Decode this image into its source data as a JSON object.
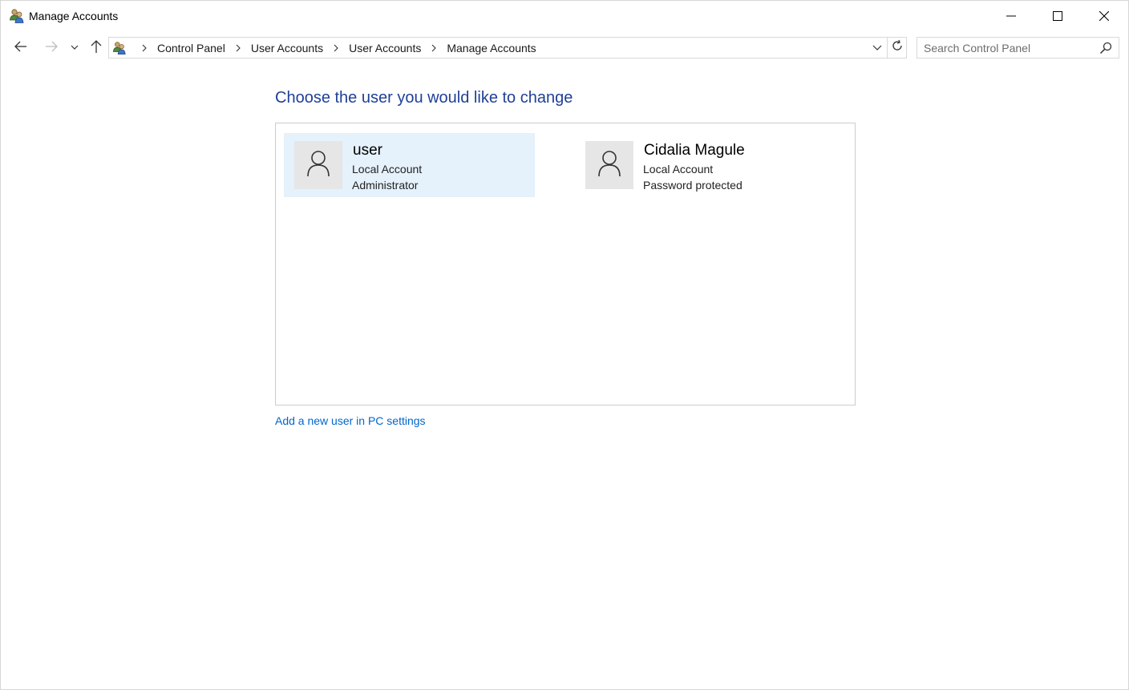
{
  "window": {
    "title": "Manage Accounts",
    "icon": "user-accounts-icon"
  },
  "controls": {
    "minimize_icon": "minimize-icon",
    "maximize_icon": "maximize-icon",
    "close_icon": "close-icon"
  },
  "nav": {
    "back_icon": "arrow-left-icon",
    "forward_icon": "arrow-right-icon",
    "recent_icon": "chevron-down-icon",
    "up_icon": "arrow-up-icon"
  },
  "address": {
    "icon": "user-accounts-icon",
    "breadcrumbs": [
      "Control Panel",
      "User Accounts",
      "User Accounts",
      "Manage Accounts"
    ],
    "dropdown_icon": "chevron-down-icon",
    "refresh_icon": "refresh-icon"
  },
  "search": {
    "placeholder": "Search Control Panel",
    "value": "",
    "icon": "search-icon"
  },
  "main": {
    "heading": "Choose the user you would like to change",
    "users": [
      {
        "name": "user",
        "account_type": "Local Account",
        "detail": "Administrator",
        "selected": true,
        "icon": "user-avatar-icon"
      },
      {
        "name": "Cidalia Magule",
        "account_type": "Local Account",
        "detail": "Password protected",
        "selected": false,
        "icon": "user-avatar-icon"
      }
    ],
    "add_user_link": "Add a new user in PC settings"
  },
  "colors": {
    "heading": "#1f3f99",
    "link": "#0066cc",
    "selected_tile": "#e5f1fb",
    "avatar_bg": "#e6e6e6"
  }
}
